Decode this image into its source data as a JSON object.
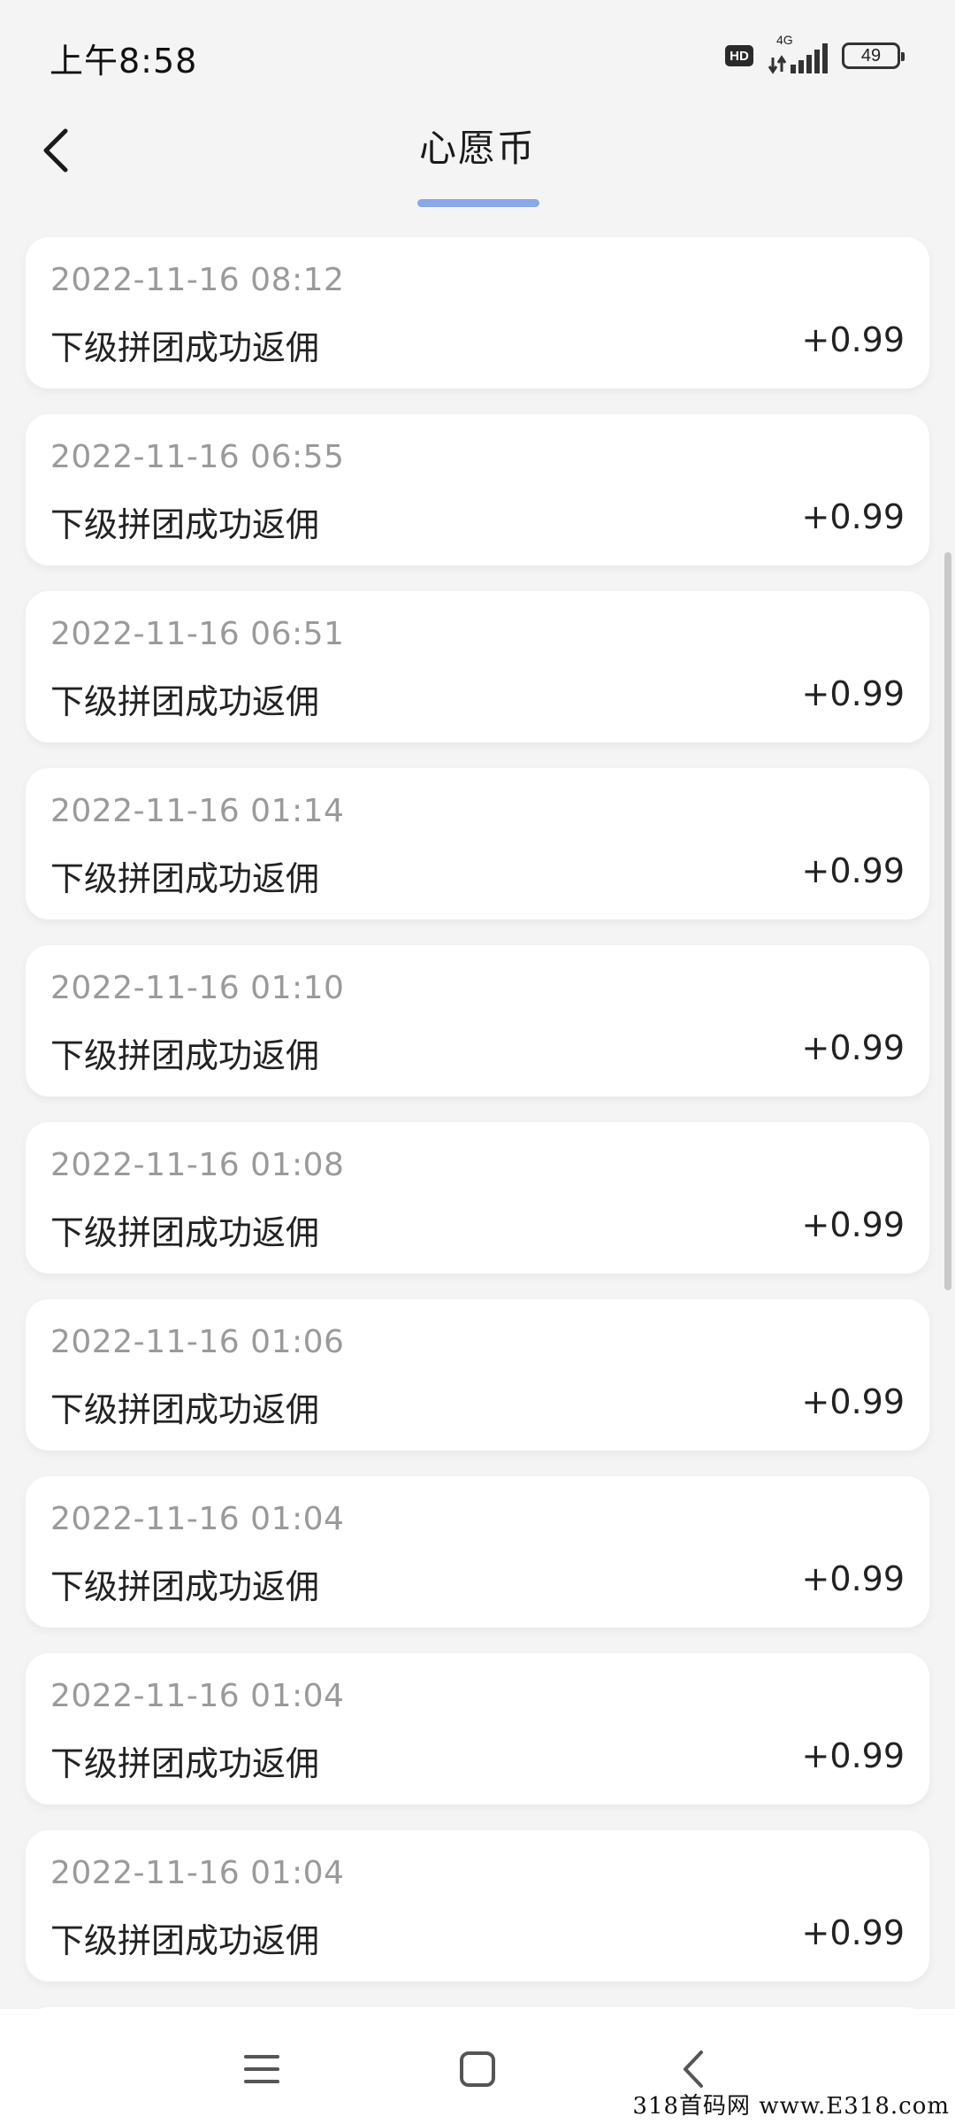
{
  "status_bar": {
    "time": "上午8:58",
    "hd_badge": "HD",
    "network": "4G",
    "battery": "49"
  },
  "header": {
    "title": "心愿币"
  },
  "records": [
    {
      "time": "2022-11-16 08:12",
      "desc": "下级拼团成功返佣",
      "amount": "+0.99"
    },
    {
      "time": "2022-11-16 06:55",
      "desc": "下级拼团成功返佣",
      "amount": "+0.99"
    },
    {
      "time": "2022-11-16 06:51",
      "desc": "下级拼团成功返佣",
      "amount": "+0.99"
    },
    {
      "time": "2022-11-16 01:14",
      "desc": "下级拼团成功返佣",
      "amount": "+0.99"
    },
    {
      "time": "2022-11-16 01:10",
      "desc": "下级拼团成功返佣",
      "amount": "+0.99"
    },
    {
      "time": "2022-11-16 01:08",
      "desc": "下级拼团成功返佣",
      "amount": "+0.99"
    },
    {
      "time": "2022-11-16 01:06",
      "desc": "下级拼团成功返佣",
      "amount": "+0.99"
    },
    {
      "time": "2022-11-16 01:04",
      "desc": "下级拼团成功返佣",
      "amount": "+0.99"
    },
    {
      "time": "2022-11-16 01:04",
      "desc": "下级拼团成功返佣",
      "amount": "+0.99"
    },
    {
      "time": "2022-11-16 01:04",
      "desc": "下级拼团成功返佣",
      "amount": "+0.99"
    }
  ],
  "icons": {
    "back": "back-arrow-icon",
    "menu": "menu-icon",
    "home": "home-icon",
    "nav_back": "nav-back-icon"
  },
  "colors": {
    "accent": "#8aa8e6",
    "background": "#f4f4f4",
    "card": "#ffffff",
    "muted_text": "#9a9a9a"
  },
  "watermark": "318首码网 www.E318.com"
}
